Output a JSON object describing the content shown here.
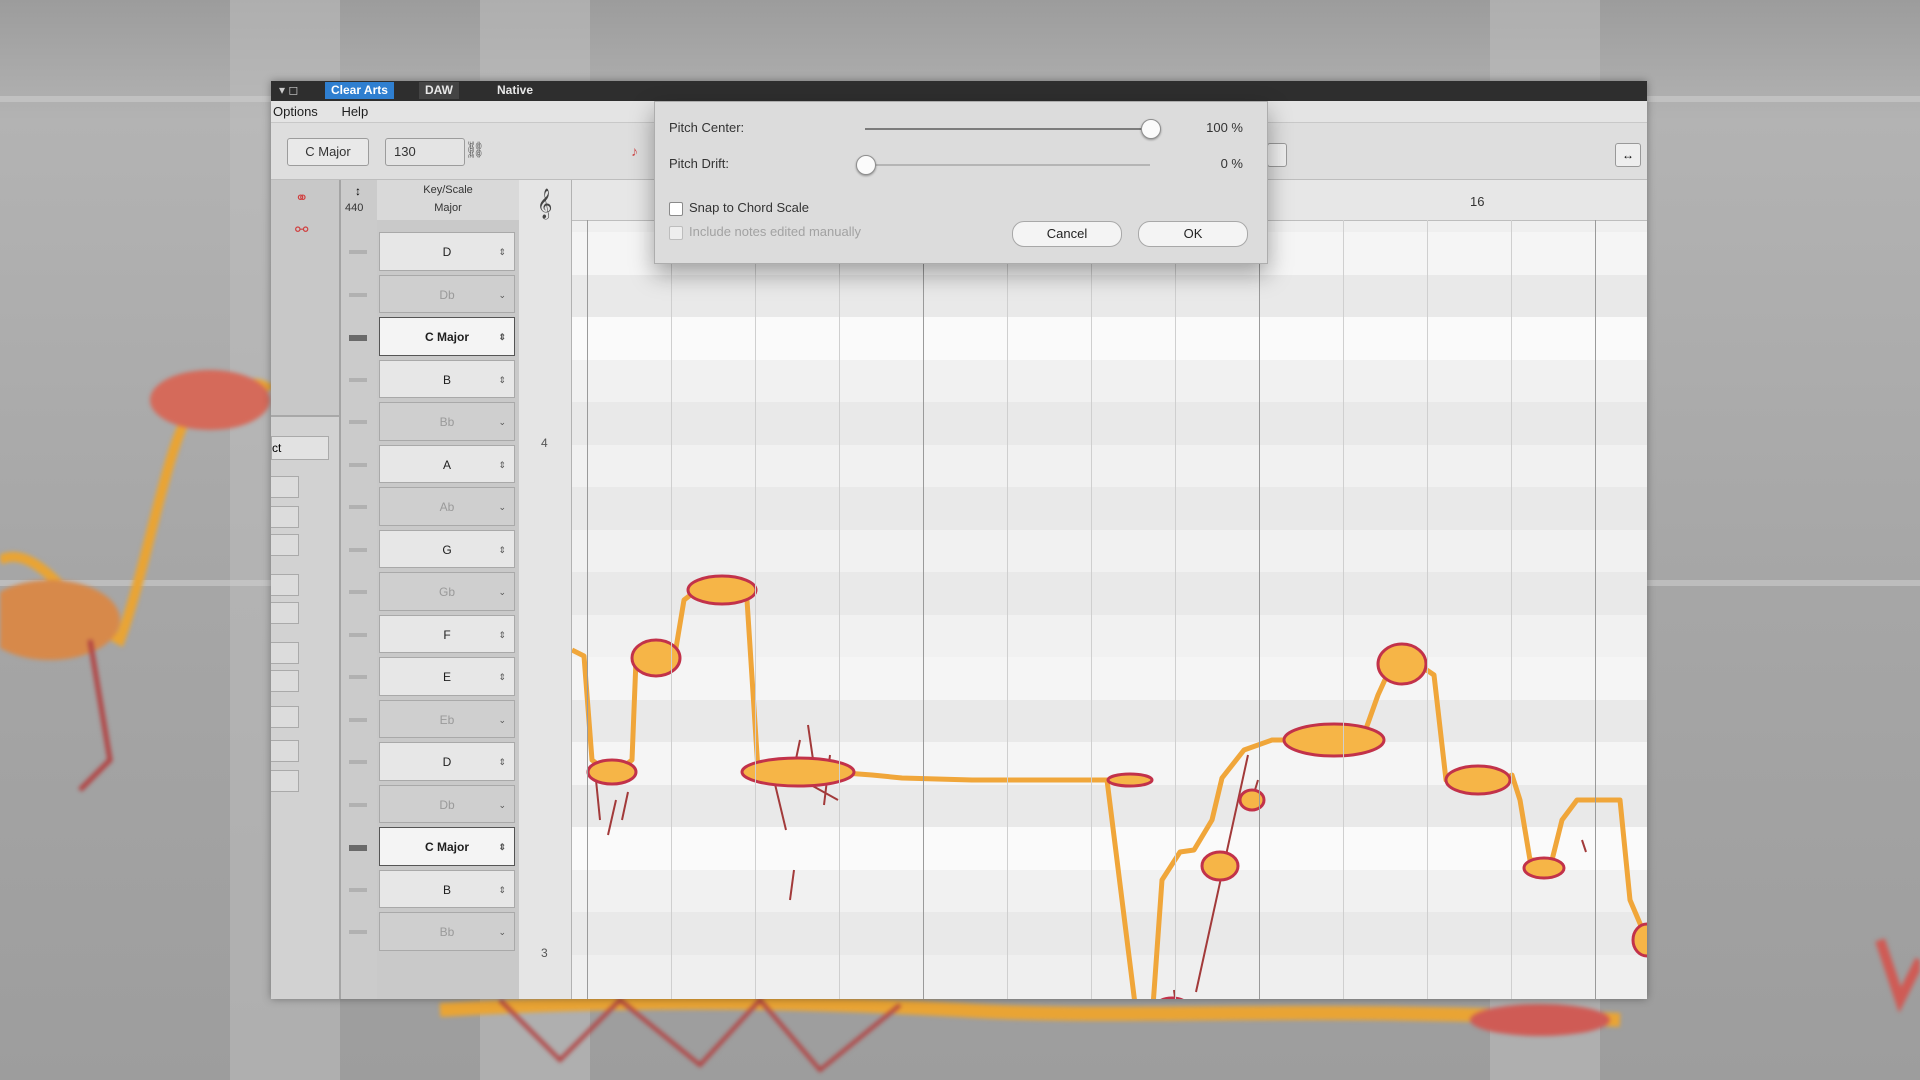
{
  "titlebar": {
    "tabs": [
      "Clear Arts",
      "DAW",
      "Native"
    ]
  },
  "menubar": {
    "items": [
      "Options",
      "Help"
    ]
  },
  "toolbar": {
    "key": "C Major",
    "tempo": "130"
  },
  "inspector": {
    "button_label": "ct"
  },
  "scale_editor": {
    "header_top": "Key/Scale",
    "header_bottom": "Major",
    "reference_pitch": "440",
    "rows": [
      {
        "label": "D",
        "kind": "natural"
      },
      {
        "label": "Db",
        "kind": "sharp"
      },
      {
        "label": "C Major",
        "kind": "major"
      },
      {
        "label": "B",
        "kind": "natural"
      },
      {
        "label": "Bb",
        "kind": "sharp"
      },
      {
        "label": "A",
        "kind": "natural"
      },
      {
        "label": "Ab",
        "kind": "sharp"
      },
      {
        "label": "G",
        "kind": "natural"
      },
      {
        "label": "Gb",
        "kind": "sharp"
      },
      {
        "label": "F",
        "kind": "natural"
      },
      {
        "label": "E",
        "kind": "natural"
      },
      {
        "label": "Eb",
        "kind": "sharp"
      },
      {
        "label": "D",
        "kind": "natural"
      },
      {
        "label": "Db",
        "kind": "sharp"
      },
      {
        "label": "C Major",
        "kind": "major"
      },
      {
        "label": "B",
        "kind": "natural"
      },
      {
        "label": "Bb",
        "kind": "sharp"
      }
    ],
    "octave_labels": [
      "4",
      "3"
    ]
  },
  "grid": {
    "bar_number": "16"
  },
  "dialog": {
    "pitch_center_label": "Pitch Center:",
    "pitch_center_value": "100 %",
    "pitch_center_level": 1.0,
    "pitch_drift_label": "Pitch Drift:",
    "pitch_drift_value": "0 %",
    "pitch_drift_level": 0.0,
    "snap_label": "Snap to Chord Scale",
    "include_label": "Include notes edited manually",
    "cancel_label": "Cancel",
    "ok_label": "OK"
  },
  "colors": {
    "blob_core": "#f6b547",
    "blob_edge": "#c2324a",
    "pitch_curve": "#f0a63a",
    "pitch_fine": "#a23a3a"
  }
}
